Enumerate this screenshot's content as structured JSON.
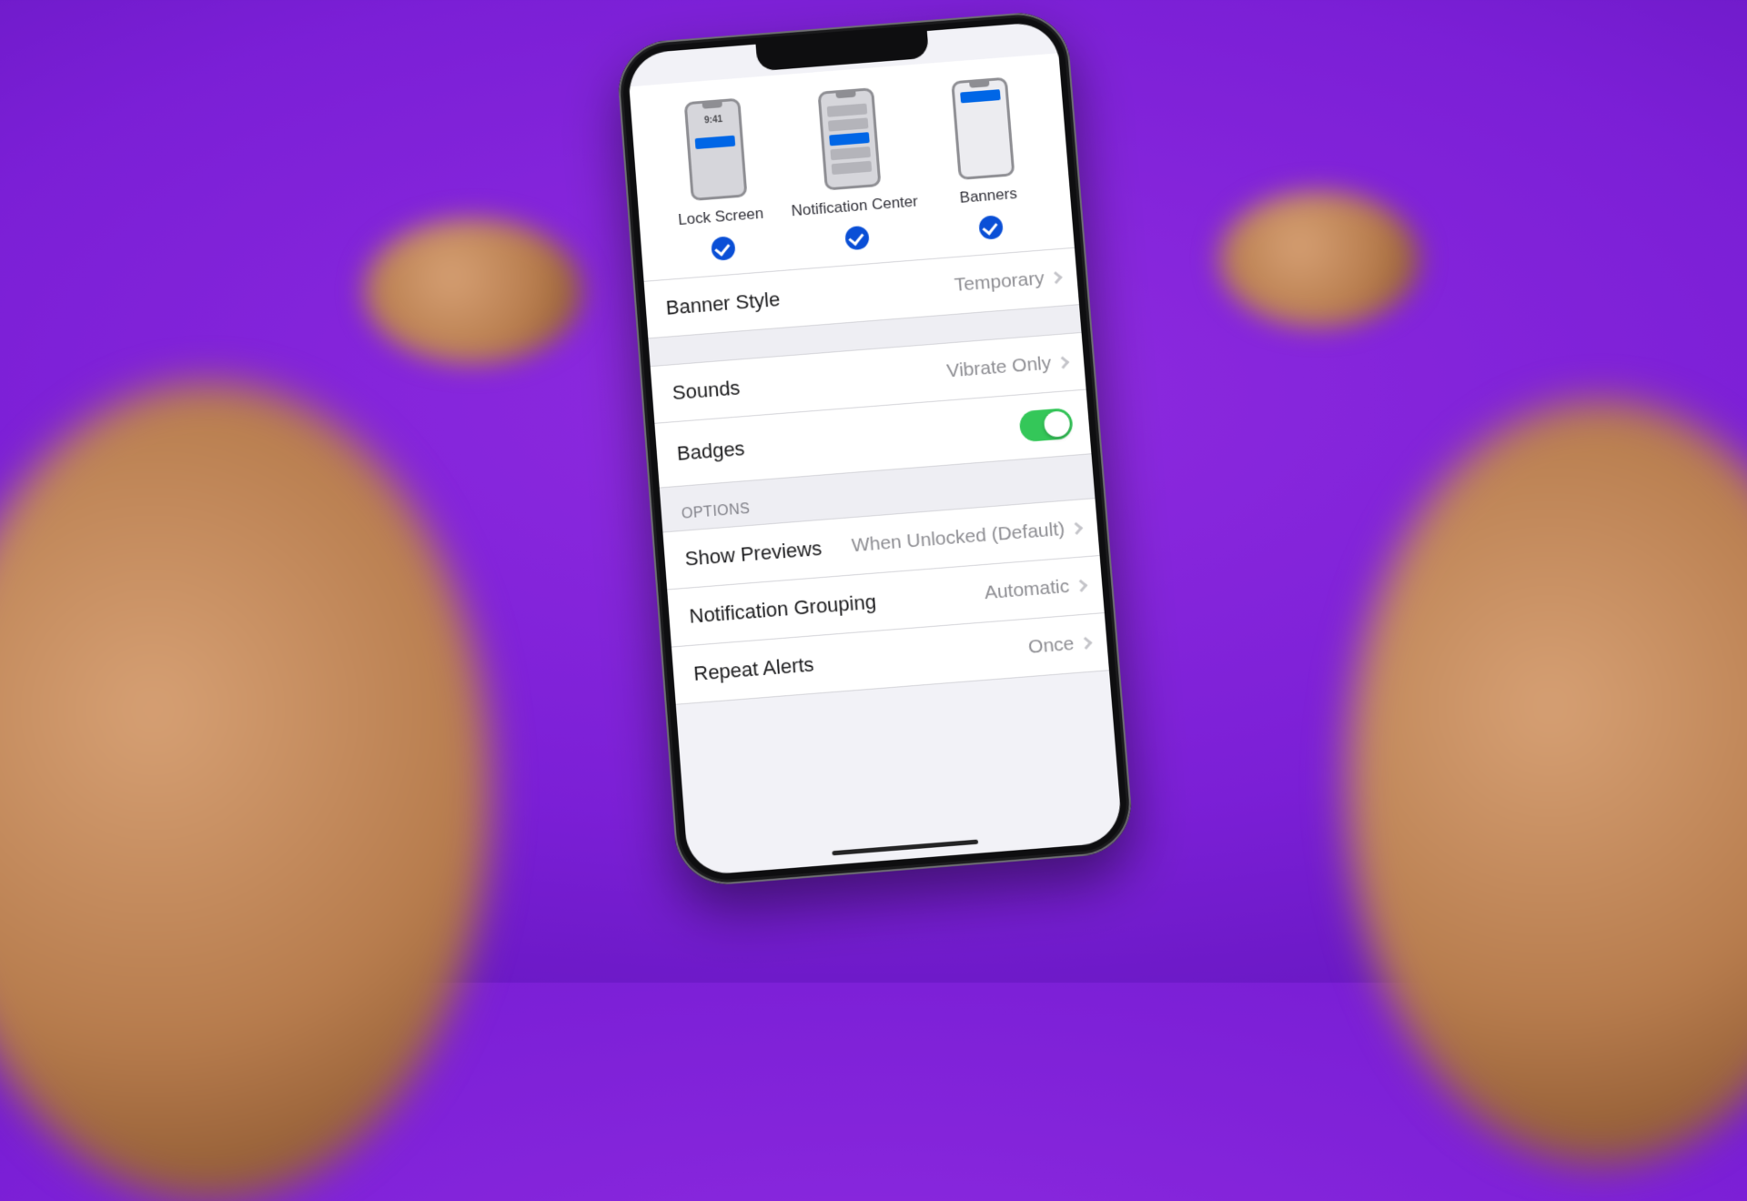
{
  "alerts": {
    "time_sample": "9:41",
    "types": [
      {
        "label": "Lock Screen",
        "checked": true
      },
      {
        "label": "Notification Center",
        "checked": true
      },
      {
        "label": "Banners",
        "checked": true
      }
    ]
  },
  "banner_style": {
    "title": "Banner Style",
    "value": "Temporary"
  },
  "sounds": {
    "title": "Sounds",
    "value": "Vibrate Only"
  },
  "badges": {
    "title": "Badges",
    "on": true
  },
  "options_header": "OPTIONS",
  "show_previews": {
    "title": "Show Previews",
    "value": "When Unlocked (Default)"
  },
  "notification_grouping": {
    "title": "Notification Grouping",
    "value": "Automatic"
  },
  "repeat_alerts": {
    "title": "Repeat Alerts",
    "value": "Once"
  }
}
